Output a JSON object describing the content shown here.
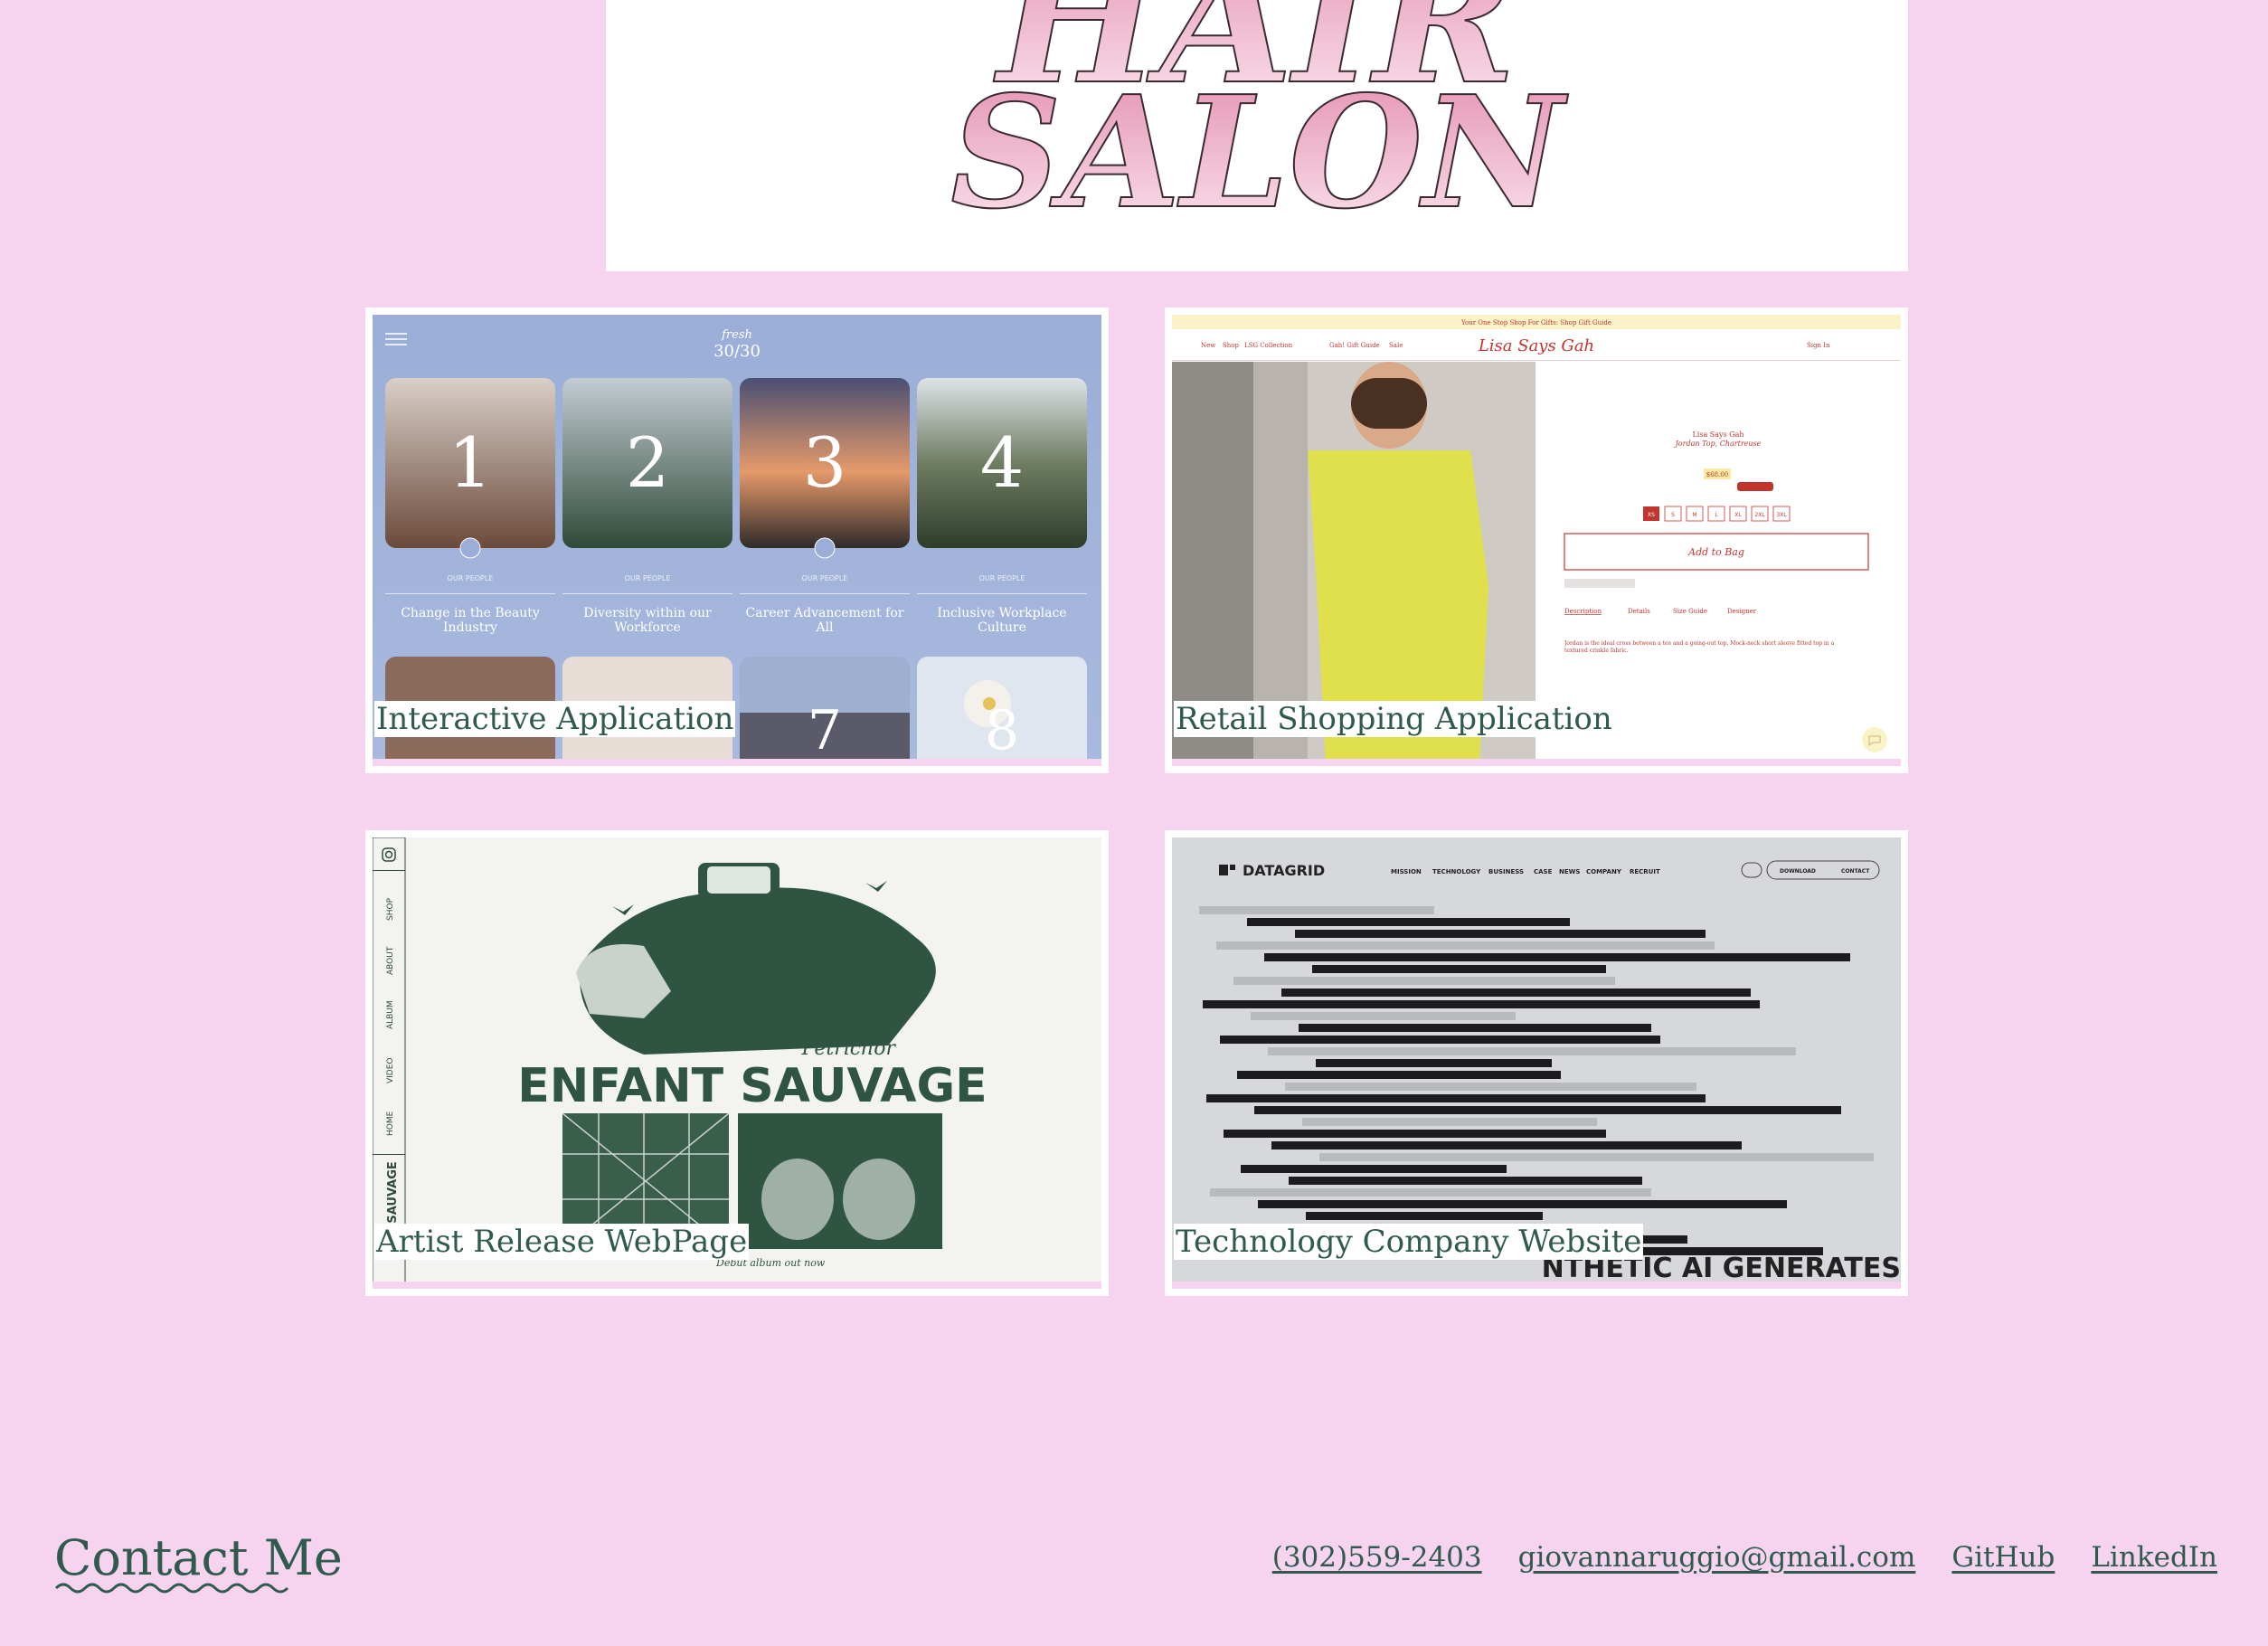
{
  "banner": {
    "logo_line1": "HAIR",
    "logo_line2": "SALON"
  },
  "projects": [
    {
      "label": "Interactive Application",
      "shot": {
        "brand_top": "fresh",
        "brand_bottom": "30/30",
        "tiles": [
          {
            "num": "1",
            "tag": "OUR PEOPLE",
            "caption_l1": "Change in the Beauty",
            "caption_l2": "Industry"
          },
          {
            "num": "2",
            "tag": "OUR PEOPLE",
            "caption_l1": "Diversity within our",
            "caption_l2": "Workforce"
          },
          {
            "num": "3",
            "tag": "OUR PEOPLE",
            "caption_l1": "Career Advancement for",
            "caption_l2": "All"
          },
          {
            "num": "4",
            "tag": "OUR PEOPLE",
            "caption_l1": "Inclusive Workplace",
            "caption_l2": "Culture"
          }
        ],
        "lower_nums": [
          "7",
          "8"
        ]
      }
    },
    {
      "label": "Retail Shopping Application",
      "shot": {
        "promo": "Your One Stop Shop For Gifts: Shop Gift Guide",
        "brand": "Lisa Says Gah",
        "nav": [
          "New",
          "Shop",
          "LSG Collection",
          "Gah! Gift Guide",
          "Sale"
        ],
        "signin": "Sign In",
        "product_brand": "Lisa Says Gah",
        "product_name": "Jordan Top, Chartreuse",
        "price": "$68.00",
        "sizes": [
          "XS",
          "S",
          "M",
          "L",
          "XL",
          "2XL",
          "3XL"
        ],
        "add_to_bag": "Add to Bag",
        "tabs": [
          "Description",
          "Details",
          "Size Guide",
          "Designer"
        ],
        "description": "Jordan is the ideal cross between a tee and a going-out top. Mock-neck short sleeve fitted top in a textured crinkle fabric."
      }
    },
    {
      "label": "Artist Release WebPage",
      "shot": {
        "side_nav": [
          "SHOP",
          "ABOUT",
          "ALBUM",
          "VIDEO",
          "HOME"
        ],
        "side_title": "T SAUVAGE",
        "album": "Petrichor",
        "artist": "ENFANT SAUVAGE",
        "tagline": "Debut album out now"
      }
    },
    {
      "label": "Technology Company Website",
      "shot": {
        "brand": "DATAGRID",
        "nav": [
          "MISSION",
          "TECHNOLOGY",
          "BUSINESS",
          "CASE",
          "NEWS",
          "COMPANY",
          "RECRUIT"
        ],
        "download": "DOWNLOAD",
        "contact": "CONTACT",
        "headline": "NTHETIC AI GENERATES"
      }
    }
  ],
  "footer": {
    "contact_title": "Contact Me",
    "phone": "(302)559-2403",
    "email": "giovannaruggio@gmail.com",
    "github": "GitHub",
    "linkedin": "LinkedIn"
  },
  "colors": {
    "background": "#f6d3ef",
    "text": "#2f5a4d",
    "logo_pink": "#e79ab8"
  }
}
